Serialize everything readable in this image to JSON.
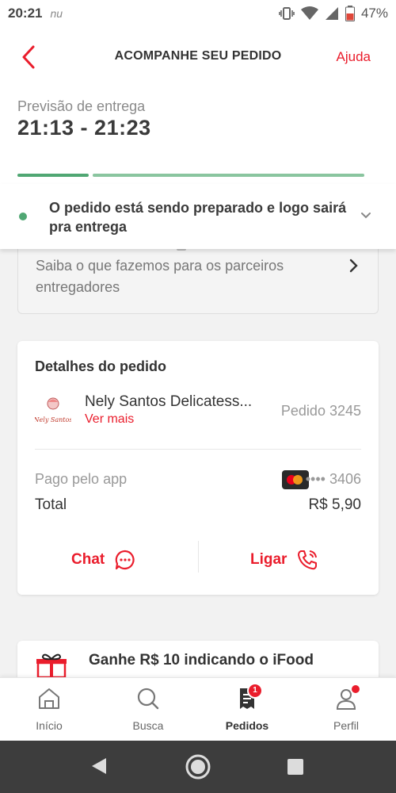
{
  "status_bar": {
    "time": "20:21",
    "carrier_icon": "nu-logo",
    "battery_percent": "47%",
    "icons": [
      "vibrate-icon",
      "wifi-icon",
      "signal-icon",
      "battery-icon"
    ]
  },
  "header": {
    "title": "ACOMPANHE SEU PEDIDO",
    "help_label": "Ajuda",
    "back_icon": "chevron-left-icon"
  },
  "forecast": {
    "label": "Previsão de entrega",
    "time_range": "21:13 - 21:23",
    "progress_segments": 2
  },
  "order_status": {
    "message": "O pedido está sendo preparado e logo sairá pra entrega",
    "indicator_color": "#50A773"
  },
  "partners_card": {
    "text": "Saiba o que fazemos para os parceiros entregadores"
  },
  "order_details": {
    "title": "Detalhes do pedido",
    "restaurant_name": "Nely Santos Delicatess...",
    "restaurant_logo_text": "Nely Santos",
    "see_more_label": "Ver mais",
    "order_number": "Pedido 3245",
    "payment_label": "Pago pelo app",
    "card_brand": "mastercard",
    "card_number": "•••• 3406",
    "total_label": "Total",
    "total_value": "R$ 5,90",
    "chat_label": "Chat",
    "call_label": "Ligar"
  },
  "promo": {
    "text": "Ganhe R$ 10 indicando o iFood"
  },
  "bottom_nav": {
    "items": [
      {
        "label": "Início",
        "icon": "home-icon"
      },
      {
        "label": "Busca",
        "icon": "search-icon"
      },
      {
        "label": "Pedidos",
        "icon": "orders-icon",
        "badge": "1",
        "active": true
      },
      {
        "label": "Perfil",
        "icon": "profile-icon"
      }
    ]
  },
  "colors": {
    "accent": "#EA1D2C",
    "success": "#50A773",
    "text": "#3E3E3E"
  }
}
